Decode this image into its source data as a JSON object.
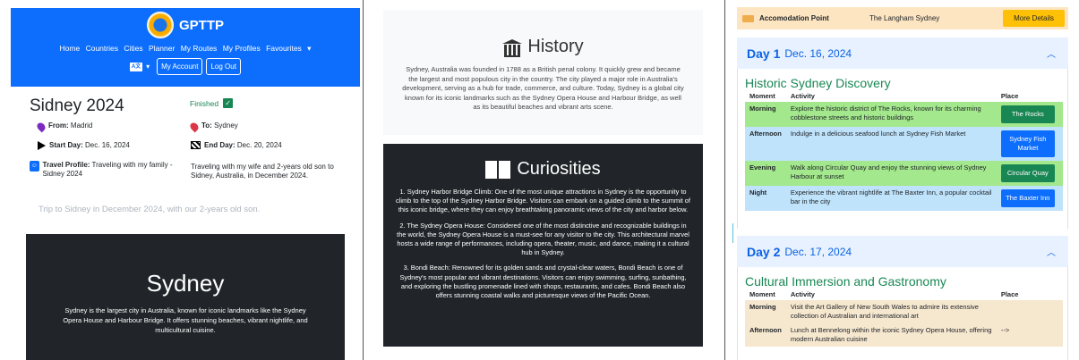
{
  "nav": {
    "brand": "GPTTP",
    "links": [
      "Home",
      "Countries",
      "Cities",
      "Planner",
      "My Routes",
      "My Profiles",
      "Favourites"
    ],
    "account_label": "My Account",
    "logout_label": "Log Out"
  },
  "trip": {
    "title": "Sidney 2024",
    "status": "Finished",
    "from_label": "From:",
    "from_value": "Madrid",
    "to_label": "To:",
    "to_value": "Sydney",
    "start_label": "Start Day:",
    "start_value": "Dec. 16, 2024",
    "end_label": "End Day:",
    "end_value": "Dec. 20, 2024",
    "profile_label": "Travel Profile:",
    "profile_value": "Traveling with my family - Sidney 2024",
    "profile_desc": "Traveling with my wife and 2-years old son to Sidney, Australia, in December 2024.",
    "description": "Trip to Sidney in December 2024, with our 2-years old son.",
    "city_name": "Sydney",
    "city_desc": "Sydney is the largest city in Australia, known for iconic landmarks like the Sydney Opera House and Harbour Bridge. It offers stunning beaches, vibrant nightlife, and multicultural cuisine."
  },
  "history": {
    "title": "History",
    "text": "Sydney, Australia was founded in 1788 as a British penal colony. It quickly grew and became the largest and most populous city in the country. The city played a major role in Australia's development, serving as a hub for trade, commerce, and culture. Today, Sydney is a global city known for its iconic landmarks such as the Sydney Opera House and Harbour Bridge, as well as its beautiful beaches and vibrant arts scene."
  },
  "curiosities": {
    "title": "Curiosities",
    "items": [
      "1. Sydney Harbor Bridge Climb: One of the most unique attractions in Sydney is the opportunity to climb to the top of the Sydney Harbor Bridge. Visitors can embark on a guided climb to the summit of this iconic bridge, where they can enjoy breathtaking panoramic views of the city and harbor below.",
      "2. The Sydney Opera House: Considered one of the most distinctive and recognizable buildings in the world, the Sydney Opera House is a must-see for any visitor to the city. This architectural marvel hosts a wide range of performances, including opera, theater, music, and dance, making it a cultural hub in Sydney.",
      "3. Bondi Beach: Renowned for its golden sands and crystal-clear waters, Bondi Beach is one of Sydney's most popular and vibrant destinations. Visitors can enjoy swimming, surfing, sunbathing, and exploring the bustling promenade lined with shops, restaurants, and cafes. Bondi Beach also offers stunning coastal walks and picturesque views of the Pacific Ocean."
    ]
  },
  "accommodation": {
    "label": "Accomodation Point",
    "name": "The Langham Sydney",
    "button": "More Details"
  },
  "day1": {
    "day": "Day 1",
    "date": "Dec. 16, 2024",
    "title": "Historic Sydney Discovery",
    "headers": [
      "Moment",
      "Activity",
      "Place"
    ],
    "rows": [
      {
        "moment": "Morning",
        "activity": "Explore the historic district of The Rocks, known for its charming cobblestone streets and historic buildings",
        "place": "The Rocks",
        "bg": "#a3e88c",
        "btn": "#198754"
      },
      {
        "moment": "Afternoon",
        "activity": "Indulge in a delicious seafood lunch at Sydney Fish Market",
        "place": "Sydney Fish Market",
        "bg": "#bfe3fb",
        "btn": "#0d6efd"
      },
      {
        "moment": "Evening",
        "activity": "Walk along Circular Quay and enjoy the stunning views of Sydney Harbour at sunset",
        "place": "Circular Quay",
        "bg": "#a3e88c",
        "btn": "#198754"
      },
      {
        "moment": "Night",
        "activity": "Experience the vibrant nightlife at The Baxter Inn, a popular cocktail bar in the city",
        "place": "The Baxter Inn",
        "bg": "#bfe3fb",
        "btn": "#0d6efd"
      }
    ]
  },
  "day2": {
    "day": "Day 2",
    "date": "Dec. 17, 2024",
    "title": "Cultural Immersion and Gastronomy",
    "headers": [
      "Moment",
      "Activity",
      "Place"
    ],
    "rows": [
      {
        "moment": "Morning",
        "activity": "Visit the Art Gallery of New South Wales to admire its extensive collection of Australian and international art",
        "place": "",
        "bg": "#f6e7cf"
      },
      {
        "moment": "Afternoon",
        "activity": "Lunch at Bennelong within the iconic Sydney Opera House, offering modern Australian cuisine",
        "place": "-->",
        "bg": "#f6e7cf"
      }
    ]
  }
}
